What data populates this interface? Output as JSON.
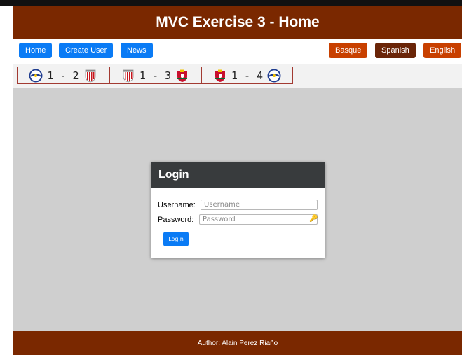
{
  "header": {
    "title": "MVC Exercise 3 - Home"
  },
  "nav": {
    "home": "Home",
    "create_user": "Create User",
    "news": "News",
    "basque": "Basque",
    "spanish": "Spanish",
    "english": "English"
  },
  "scores": [
    {
      "home_team_icon": "alaves-crest-icon",
      "score": "1 - 2",
      "away_team_icon": "athletic-crest-icon"
    },
    {
      "home_team_icon": "athletic-crest-icon",
      "score": "1 - 3",
      "away_team_icon": "osasuna-crest-icon"
    },
    {
      "home_team_icon": "osasuna-crest-icon",
      "score": "1 - 4",
      "away_team_icon": "alaves-crest-icon"
    }
  ],
  "login": {
    "title": "Login",
    "username_label": "Username:",
    "username_placeholder": "Username",
    "username_value": "",
    "password_label": "Password:",
    "password_placeholder": "Password",
    "password_value": "",
    "password_icon": "key-icon",
    "submit": "Login"
  },
  "footer": {
    "author": "Author: Alain Perez Riaño"
  },
  "colors": {
    "brand": "#7a2800",
    "primary": "#0a7bf5",
    "accent_orange": "#c84000",
    "accent_brown": "#6a2508",
    "modal_header": "#383b3d",
    "content_bg": "#cfcfcf"
  }
}
